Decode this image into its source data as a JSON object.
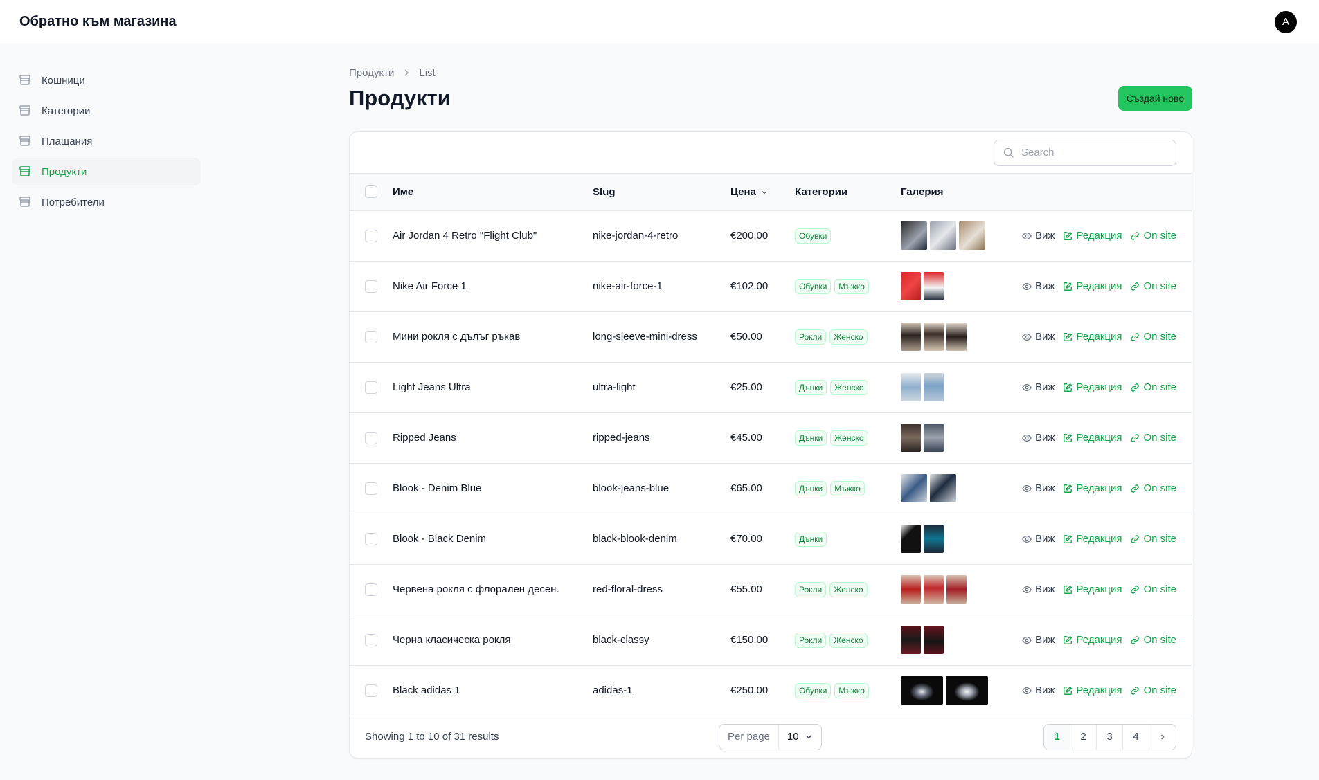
{
  "header": {
    "brand": "Обратно към магазина",
    "avatar_letter": "A"
  },
  "sidebar": {
    "items": [
      {
        "label": "Кошници",
        "active": false
      },
      {
        "label": "Категории",
        "active": false
      },
      {
        "label": "Плащания",
        "active": false
      },
      {
        "label": "Продукти",
        "active": true
      },
      {
        "label": "Потребители",
        "active": false
      }
    ]
  },
  "breadcrumb": {
    "root": "Продукти",
    "current": "List"
  },
  "page": {
    "title": "Продукти",
    "create_label": "Създай ново"
  },
  "search": {
    "placeholder": "Search",
    "value": ""
  },
  "table": {
    "headers": {
      "name": "Име",
      "slug": "Slug",
      "price": "Цена",
      "categories": "Категории",
      "gallery": "Галерия"
    },
    "action_labels": {
      "view": "Виж",
      "edit": "Редакция",
      "onsite": "On site"
    },
    "rows": [
      {
        "name": "Air Jordan 4 Retro \"Flight Club\"",
        "slug": "nike-jordan-4-retro",
        "price": "€200.00",
        "categories": [
          "Обувки"
        ]
      },
      {
        "name": "Nike Air Force 1",
        "slug": "nike-air-force-1",
        "price": "€102.00",
        "categories": [
          "Обувки",
          "Мъжко"
        ]
      },
      {
        "name": "Мини рокля с дълъг ръкав",
        "slug": "long-sleeve-mini-dress",
        "price": "€50.00",
        "categories": [
          "Рокли",
          "Женско"
        ]
      },
      {
        "name": "Light Jeans Ultra",
        "slug": "ultra-light",
        "price": "€25.00",
        "categories": [
          "Дънки",
          "Женско"
        ]
      },
      {
        "name": "Ripped Jeans",
        "slug": "ripped-jeans",
        "price": "€45.00",
        "categories": [
          "Дънки",
          "Женско"
        ]
      },
      {
        "name": "Blook - Denim Blue",
        "slug": "blook-jeans-blue",
        "price": "€65.00",
        "categories": [
          "Дънки",
          "Мъжко"
        ]
      },
      {
        "name": "Blook - Black Denim",
        "slug": "black-blook-denim",
        "price": "€70.00",
        "categories": [
          "Дънки"
        ]
      },
      {
        "name": "Червена рокля с флорален десен.",
        "slug": "red-floral-dress",
        "price": "€55.00",
        "categories": [
          "Рокли",
          "Женско"
        ]
      },
      {
        "name": "Черна класическа рокля",
        "slug": "black-classy",
        "price": "€150.00",
        "categories": [
          "Рокли",
          "Женско"
        ]
      },
      {
        "name": "Black adidas 1",
        "slug": "adidas-1",
        "price": "€250.00",
        "categories": [
          "Обувки",
          "Мъжко"
        ]
      }
    ]
  },
  "footer": {
    "showing": "Showing 1 to 10 of 31 results",
    "per_page_label": "Per page",
    "per_page_value": "10",
    "pages": [
      "1",
      "2",
      "3",
      "4"
    ],
    "current_page": "1"
  },
  "colors": {
    "accent": "#16a34a",
    "button": "#22c55e"
  }
}
